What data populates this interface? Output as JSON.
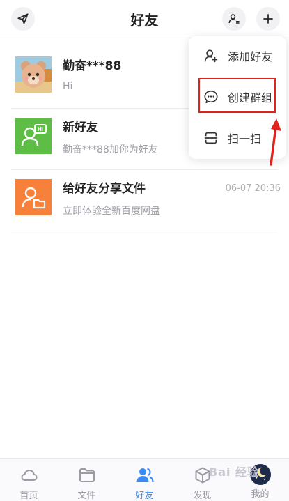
{
  "header": {
    "title": "好友"
  },
  "conversations": [
    {
      "name": "勤奋***88",
      "preview": "Hi",
      "time": ""
    },
    {
      "name": "新好友",
      "preview": "勤奋***88加你为好友",
      "time": ""
    },
    {
      "name": "给好友分享文件",
      "preview": "立即体验全新百度网盘",
      "time": "06-07 20:36"
    }
  ],
  "popup_menu": {
    "items": [
      {
        "label": "添加好友",
        "icon": "add-friend-icon"
      },
      {
        "label": "创建群组",
        "icon": "chat-bubble-icon"
      },
      {
        "label": "扫一扫",
        "icon": "scan-icon"
      }
    ]
  },
  "bottom_nav": {
    "tabs": [
      {
        "label": "首页",
        "icon": "cloud-icon"
      },
      {
        "label": "文件",
        "icon": "folder-icon"
      },
      {
        "label": "好友",
        "icon": "friends-icon"
      },
      {
        "label": "发现",
        "icon": "cube-icon"
      },
      {
        "label": "我的",
        "icon": "avatar-icon"
      }
    ],
    "active": "好友"
  },
  "watermark": {
    "text": "Bai 经验"
  },
  "colors": {
    "accent": "#3a8bf5",
    "new_friend_tile": "#5ebd44",
    "share_tile": "#f7813a",
    "highlight": "#e0231a"
  }
}
